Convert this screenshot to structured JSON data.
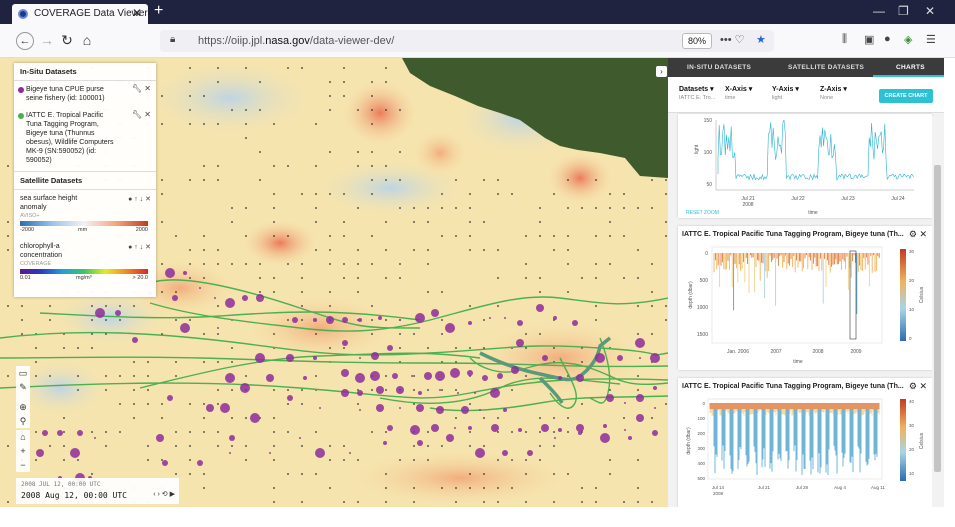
{
  "browser": {
    "tab_title": "COVERAGE Data Viewer",
    "tab_close": "✕",
    "new_tab": "+",
    "url_prefix": "https://oiip.jpl.",
    "url_domain": "nasa.gov",
    "url_path": "/data-viewer-dev/",
    "zoom": "80%"
  },
  "map": {
    "insitu_header": "In-Situ Datasets",
    "insitu_items": [
      {
        "label": "Bigeye tuna CPUE purse seine fishery (id: 100001)",
        "color": "#8e2c9b"
      },
      {
        "label": "IATTC E. Tropical Pacific Tuna Tagging Program, Bigeye tuna (Thunnus obesus), Wildlife Computers MK-9 (SN:590052) (id: 590052)",
        "color": "#4caf50"
      }
    ],
    "satellite_header": "Satellite Datasets",
    "satellite_items": [
      {
        "label": "sea surface height anomaly",
        "source": "AVISO+",
        "scale_min": "-2000",
        "scale_unit": "mm",
        "scale_max": "2000"
      },
      {
        "label": "chlorophyll-a concentration",
        "source": "COVERAGE",
        "scale_min": "0.01",
        "scale_unit": "mg/m³",
        "scale_max": "> 20.0"
      }
    ],
    "time_top": "2008 JUL 12, 00:00 UTC",
    "time_main": "2008 Aug 12, 00:00 UTC",
    "time_controls": "‹ › ⟲ ▶",
    "colors": {
      "land": "#3f5a2d",
      "track": "#4caf50",
      "points": "#8e2c9b"
    }
  },
  "panel": {
    "tabs": [
      "IN-SITU DATASETS",
      "SATELLITE DATASETS",
      "CHARTS"
    ],
    "active_tab": "CHARTS",
    "axes": [
      {
        "label": "Datasets",
        "sub": "IATTC E. Tro..."
      },
      {
        "label": "X-Axis",
        "sub": "time"
      },
      {
        "label": "Y-Axis",
        "sub": "light"
      },
      {
        "label": "Z-Axis",
        "sub": "None"
      }
    ],
    "create_chart": "CREATE CHART",
    "reset_zoom": "RESET ZOOM",
    "chart1": {
      "ylabel": "light",
      "xlabel": "time",
      "yticks": [
        "150",
        "100",
        "50"
      ],
      "xticks": [
        "Jul 21\n2008",
        "Jul 22",
        "Jul 23",
        "Jul 24"
      ]
    },
    "chart2": {
      "title": "IATTC E. Tropical Pacific Tuna Tagging Program, Bigeye tuna (Th...",
      "ylabel": "depth (dbar)",
      "xlabel": "time",
      "yticks": [
        "0",
        "500",
        "1000",
        "1500"
      ],
      "xticks": [
        "Jan. 2006",
        "2007",
        "2008",
        "2009"
      ],
      "colorbar_label": "Celsius",
      "colorbar_ticks": [
        "30",
        "20",
        "10",
        "0"
      ]
    },
    "chart3": {
      "title": "IATTC E. Tropical Pacific Tuna Tagging Program, Bigeye tuna (Th...",
      "ylabel": "depth (dbar)",
      "yticks": [
        "0",
        "100",
        "200",
        "300",
        "400",
        "500"
      ],
      "xticks": [
        "Jul 14\n2008",
        "Jul 21",
        "Jul 28",
        "Aug 4",
        "Aug 11"
      ],
      "colorbar_label": "Celsius",
      "colorbar_ticks": [
        "40",
        "30",
        "20",
        "10"
      ]
    }
  }
}
